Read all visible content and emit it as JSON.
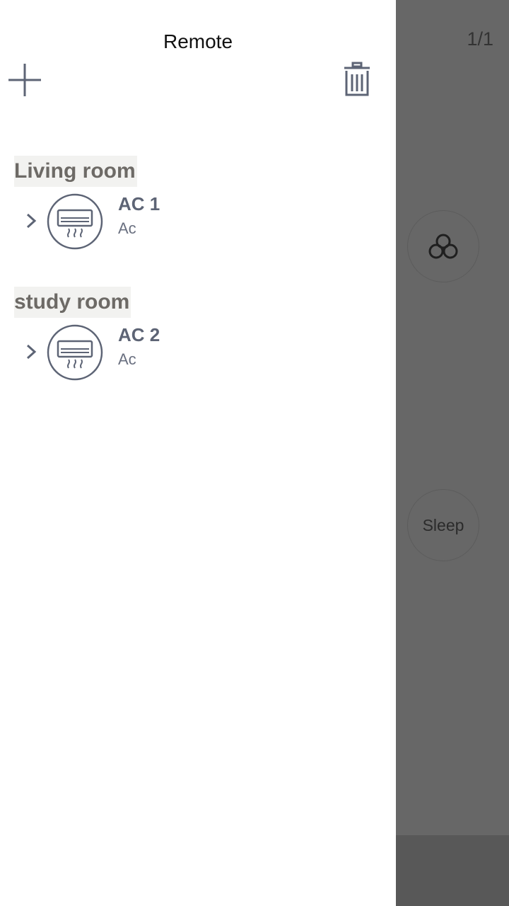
{
  "background": {
    "page_indicator": "1/1",
    "fan_icon": "fan-icon",
    "sleep_label": "Sleep"
  },
  "drawer": {
    "title": "Remote",
    "add_icon": "plus-icon",
    "delete_icon": "trash-icon",
    "groups": [
      {
        "label": "Living room",
        "devices": [
          {
            "name": "AC 1",
            "type": "Ac",
            "icon": "air-conditioner-icon"
          }
        ]
      },
      {
        "label": "study room",
        "devices": [
          {
            "name": "AC 2",
            "type": "Ac",
            "icon": "air-conditioner-icon"
          }
        ]
      }
    ]
  },
  "colors": {
    "drawer_bg": "#ffffff",
    "overlay_bg": "#676767",
    "icon_stroke": "#5d6475",
    "group_label_bg": "#f2f2f0",
    "group_label_text": "#6d6a66"
  }
}
